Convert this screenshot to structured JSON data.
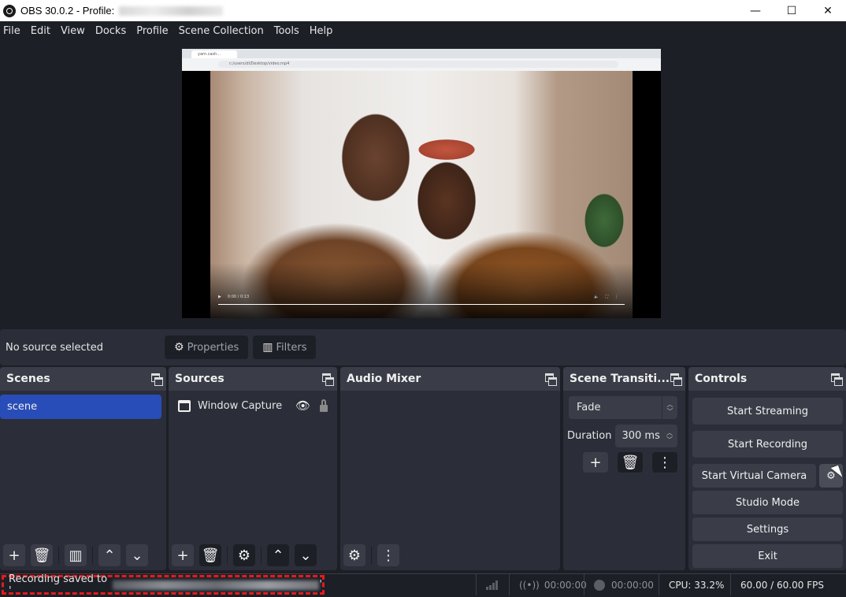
{
  "window": {
    "title": "OBS 30.0.2 - Profile:",
    "controls": {
      "minimize": "—",
      "maximize": "☐",
      "close": "✕"
    }
  },
  "menu": [
    "File",
    "Edit",
    "View",
    "Docks",
    "Profile",
    "Scene Collection",
    "Tools",
    "Help"
  ],
  "preview": {
    "browser_tab": "yarn.cash...",
    "browser_url": "c:/users/dl/Desktop/video.mp4",
    "video_time": "0:00 / 0:13"
  },
  "source_bar": {
    "status": "No source selected",
    "properties_label": "Properties",
    "filters_label": "Filters"
  },
  "docks": {
    "scenes": {
      "title": "Scenes",
      "items": [
        "scene"
      ]
    },
    "sources": {
      "title": "Sources",
      "items": [
        {
          "name": "Window Capture",
          "visible": true,
          "locked": false
        }
      ]
    },
    "audio_mixer": {
      "title": "Audio Mixer"
    },
    "transitions": {
      "title": "Scene Transiti...",
      "selected": "Fade",
      "duration_label": "Duration",
      "duration_value": "300 ms"
    },
    "controls": {
      "title": "Controls",
      "start_streaming": "Start Streaming",
      "start_recording": "Start Recording",
      "start_virtual_camera": "Start Virtual Camera",
      "studio_mode": "Studio Mode",
      "settings": "Settings",
      "exit": "Exit"
    }
  },
  "statusbar": {
    "message": "Recording saved to '",
    "message_end": "'",
    "stream_time": "00:00:00",
    "record_time": "00:00:00",
    "cpu": "CPU: 33.2%",
    "fps": "60.00 / 60.00 FPS"
  },
  "colors": {
    "accent": "#284cb8",
    "highlight_box": "#e8191b",
    "background": "#1d1f26",
    "panel": "#2b2e38"
  }
}
